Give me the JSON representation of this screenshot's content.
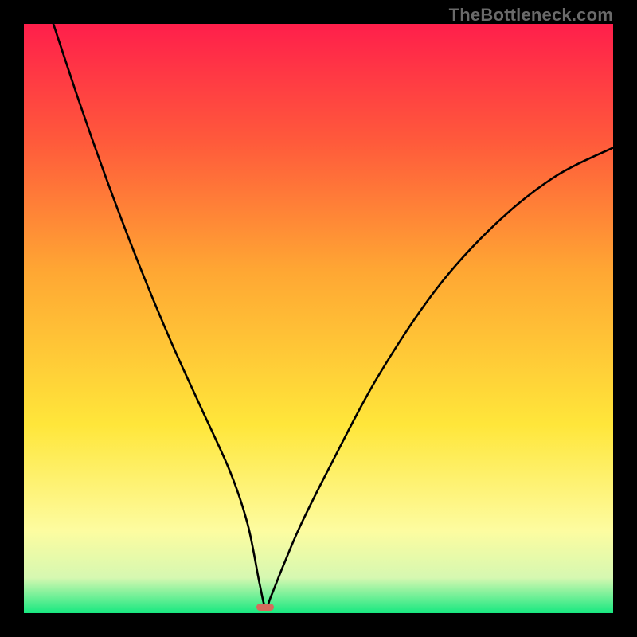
{
  "watermark": "TheBottleneck.com",
  "colors": {
    "frame": "#000000",
    "grad_top": "#ff1f4b",
    "grad_mid1": "#ff5a3b",
    "grad_mid2": "#ffa733",
    "grad_mid3": "#ffe63a",
    "grad_mid4": "#fdfca0",
    "grad_mid5": "#d6f8b1",
    "grad_bottom": "#17e880",
    "curve": "#000000",
    "marker": "#d56b5c"
  },
  "chart_data": {
    "type": "line",
    "title": "",
    "xlabel": "",
    "ylabel": "",
    "xlim": [
      0,
      100
    ],
    "ylim": [
      0,
      100
    ],
    "notch_x": 41,
    "series": [
      {
        "name": "curve",
        "x": [
          5,
          10,
          15,
          20,
          25,
          30,
          35,
          38,
          40,
          41,
          42,
          44,
          47,
          52,
          60,
          70,
          80,
          90,
          100
        ],
        "y": [
          100,
          85,
          71,
          58,
          46,
          35,
          24,
          15,
          5,
          1,
          3,
          8,
          15,
          25,
          40,
          55,
          66,
          74,
          79
        ]
      }
    ],
    "marker": {
      "x": 41,
      "y": 1,
      "w_pct": 3.0,
      "h_pct": 1.3
    }
  }
}
